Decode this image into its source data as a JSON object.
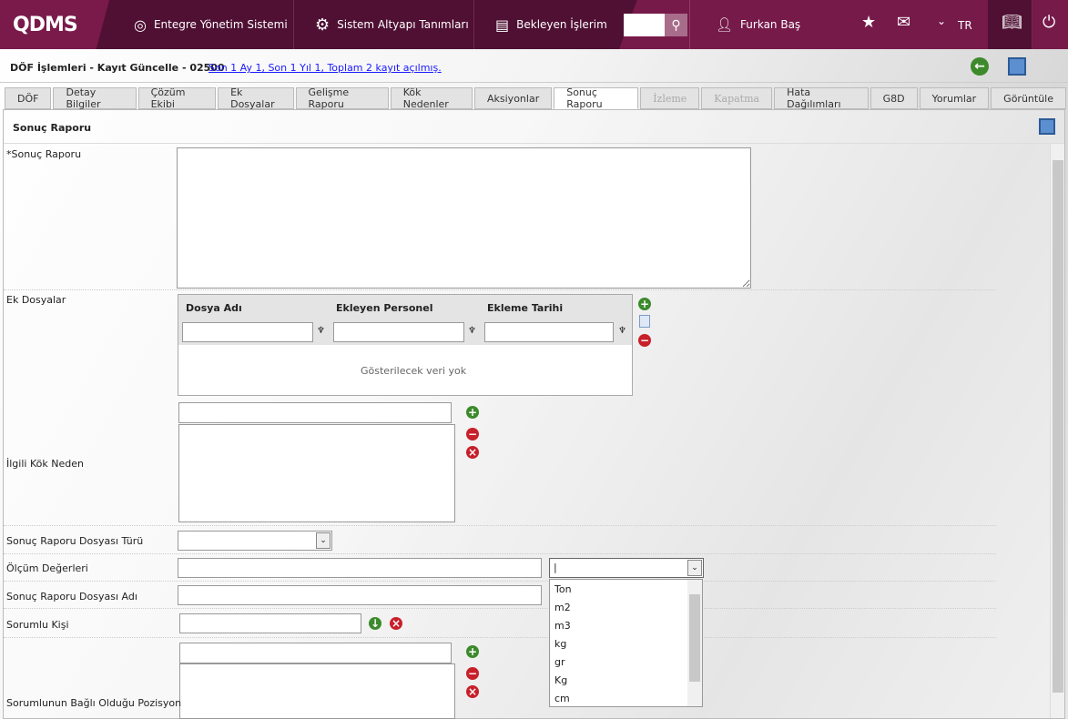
{
  "header": {
    "logo": "QDMS",
    "nav": [
      {
        "label": "Entegre Yönetim Sistemi",
        "icon": "q-icon"
      },
      {
        "label": "Sistem Altyapı Tanımları",
        "icon": "gear-icon"
      },
      {
        "label": "Bekleyen İşlerim",
        "icon": "clipboard-icon"
      }
    ],
    "user": "Furkan Baş",
    "lang": "TR"
  },
  "titlebar": {
    "title": "DÖF İşlemleri - Kayıt Güncelle - 02500",
    "summary": "Son 1 Ay 1, Son 1 Yıl 1, Toplam 2 kayıt açılmış."
  },
  "tabs": [
    {
      "label": "DÖF"
    },
    {
      "label": "Detay Bilgiler"
    },
    {
      "label": "Çözüm Ekibi"
    },
    {
      "label": "Ek Dosyalar"
    },
    {
      "label": "Gelişme Raporu"
    },
    {
      "label": "Kök Nedenler"
    },
    {
      "label": "Aksiyonlar"
    },
    {
      "label": "Sonuç Raporu",
      "active": true
    },
    {
      "label": "İzleme",
      "disabled": true
    },
    {
      "label": "Kapatma",
      "disabled": true
    },
    {
      "label": "Hata Dağılımları"
    },
    {
      "label": "G8D"
    },
    {
      "label": "Yorumlar"
    },
    {
      "label": "Görüntüle"
    }
  ],
  "form": {
    "section_title": "Sonuç Raporu",
    "sonuc_raporu_label": "*Sonuç Raporu",
    "ek_dosyalar_label": "Ek Dosyalar",
    "grid": {
      "columns": [
        "Dosya Adı",
        "Ekleyen Personel",
        "Ekleme Tarihi"
      ],
      "empty": "Gösterilecek veri yok"
    },
    "kok_neden_label": "İlgili Kök Neden",
    "dosya_turu_label": "Sonuç Raporu Dosyası Türü",
    "olcum_label": "Ölçüm Değerleri",
    "dosya_adi_label": "Sonuç Raporu Dosyası Adı",
    "sorumlu_label": "Sorumlu Kişi",
    "pozisyon_label": "Sorumlunun Bağlı Olduğu Pozisyon"
  },
  "unit_dropdown": {
    "options": [
      "Ton",
      "m2",
      "m3",
      "kg",
      "gr",
      "Kg",
      "cm"
    ]
  }
}
